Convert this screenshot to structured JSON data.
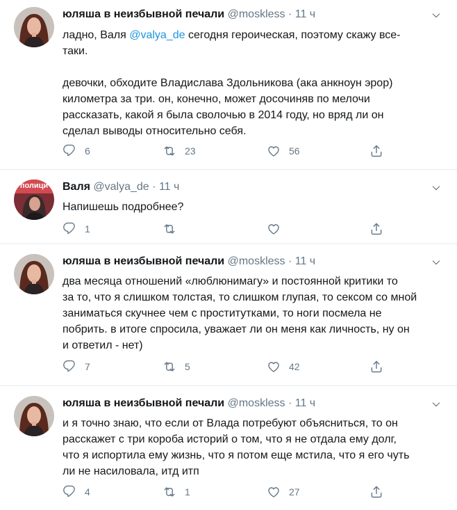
{
  "tweets": [
    {
      "author_name": "юляша в неизбывной печали",
      "handle": "@moskless",
      "time": "11 ч",
      "line1_pre": "ладно, Валя ",
      "line1_mention": "@valya_de",
      "line1_post": " сегодня героическая, поэтому скажу все-",
      "line2": "таки.",
      "para2": [
        "девочки, обходите Владислава Здольникова (ака анкноун эрор)",
        "километра за три. он, конечно, может досочиняв по мелочи",
        "рассказать, какой я была сволочью в 2014 году, но вряд ли он",
        "сделал выводы относительно себя."
      ],
      "replies": "6",
      "retweets": "23",
      "likes": "56"
    },
    {
      "author_name": "Валя",
      "handle": "@valya_de",
      "time": "11 ч",
      "avatar_text": "полици",
      "text": "Напишешь подробнее?",
      "replies": "1",
      "retweets": "",
      "likes": ""
    },
    {
      "author_name": "юляша в неизбывной печали",
      "handle": "@moskless",
      "time": "11 ч",
      "lines": [
        "два месяца отношений «люблюнимагу» и постоянной критики то",
        "за то, что я слишком толстая, то слишком глупая, то сексом со мной",
        "заниматься скучнее чем с проститутками, то ноги посмела не",
        "побрить. в итоге спросила, уважает ли он меня как личность, ну он",
        "и ответил - нет)"
      ],
      "replies": "7",
      "retweets": "5",
      "likes": "42"
    },
    {
      "author_name": "юляша в неизбывной печали",
      "handle": "@moskless",
      "time": "11 ч",
      "lines": [
        "и я точно знаю, что если от Влада потребуют объясниться, то он",
        "расскажет с три короба историй о том, что я не отдала ему долг,",
        "что я испортила ему жизнь, что я потом еще мстила, что я его чуть",
        "ли не насиловала, итд итп"
      ],
      "replies": "4",
      "retweets": "1",
      "likes": "27"
    }
  ],
  "separator": "·",
  "colors": {
    "link": "#1b95e0",
    "muted": "#657786",
    "text": "#14171a"
  }
}
